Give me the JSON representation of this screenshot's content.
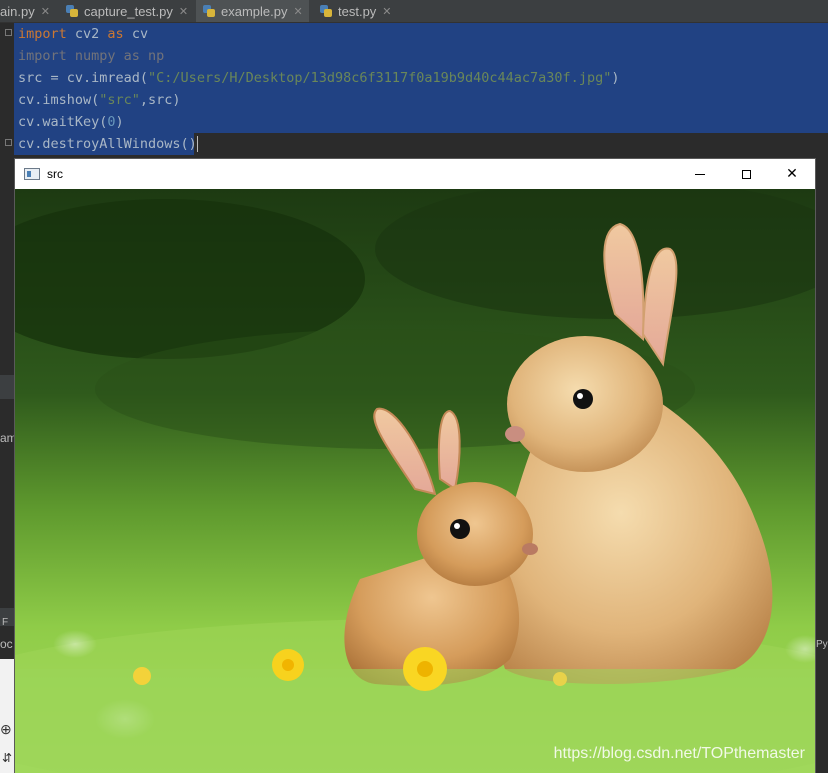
{
  "tabs": [
    {
      "label": "ain.py",
      "active": false
    },
    {
      "label": "capture_test.py",
      "active": false
    },
    {
      "label": "example.py",
      "active": true
    },
    {
      "label": "test.py",
      "active": false
    }
  ],
  "code": {
    "line1": {
      "kw1": "import",
      "mod": " cv2 ",
      "kw2": "as",
      "alias": " cv"
    },
    "line2": {
      "text": "import numpy as np"
    },
    "line3": {
      "pre": "src = cv.imread(",
      "str": "\"C:/Users/H/Desktop/13d98c6f3117f0a19b9d40c44ac7a30f.jpg\"",
      "post": ")"
    },
    "line4": {
      "pre": "cv.imshow(",
      "str": "\"src\"",
      "post": ",src)"
    },
    "line5": {
      "pre": "cv.waitKey(",
      "num": "0",
      "post": ")"
    },
    "line6": {
      "text": "cv.destroyAllWindows()"
    }
  },
  "fragments": {
    "left1": "amp",
    "left2": "oc",
    "left3": "F",
    "right1": "Py"
  },
  "window": {
    "title": "src",
    "minimize_glyph": "—",
    "maximize_glyph": "☐",
    "close_glyph": "✕"
  },
  "photo": {
    "watermark": "https://blog.csdn.net/TOPthemaster"
  },
  "colors": {
    "ide_bg": "#2b2b2b",
    "selection": "#214283",
    "keyword": "#cc7832",
    "string": "#6a8759",
    "number": "#6897bb"
  }
}
